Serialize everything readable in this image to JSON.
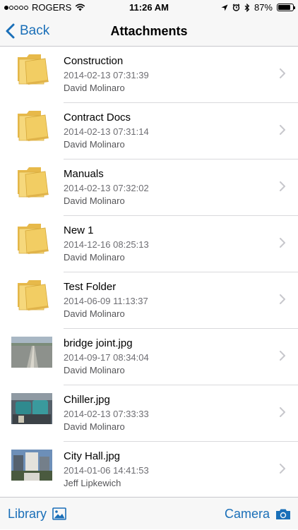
{
  "status_bar": {
    "carrier": "ROGERS",
    "time": "11:26 AM",
    "battery": "87%",
    "battery_level": 0.87,
    "signal_bars_filled": 1,
    "signal_bars_total": 5,
    "icons": [
      "wifi-icon",
      "location-icon",
      "alarm-icon",
      "bluetooth-icon"
    ]
  },
  "nav": {
    "back_label": "Back",
    "title": "Attachments"
  },
  "colors": {
    "accent": "#1a6fb8",
    "folder": "#f2cd63",
    "secondary_text": "#6d6d72"
  },
  "items": [
    {
      "kind": "folder",
      "name": "Construction",
      "date": "2014-02-13 07:31:39",
      "user": "David Molinaro"
    },
    {
      "kind": "folder",
      "name": "Contract Docs",
      "date": "2014-02-13 07:31:14",
      "user": "David Molinaro"
    },
    {
      "kind": "folder",
      "name": "Manuals",
      "date": "2014-02-13 07:32:02",
      "user": "David Molinaro"
    },
    {
      "kind": "folder",
      "name": "New 1",
      "date": "2014-12-16 08:25:13",
      "user": "David Molinaro"
    },
    {
      "kind": "folder",
      "name": "Test Folder",
      "date": "2014-06-09 11:13:37",
      "user": "David Molinaro"
    },
    {
      "kind": "image",
      "name": "bridge joint.jpg",
      "date": "2014-09-17 08:34:04",
      "user": "David Molinaro"
    },
    {
      "kind": "image",
      "name": "Chiller.jpg",
      "date": "2014-02-13 07:33:33",
      "user": "David Molinaro"
    },
    {
      "kind": "image",
      "name": "City Hall.jpg",
      "date": "2014-01-06 14:41:53",
      "user": "Jeff Lipkewich"
    }
  ],
  "toolbar": {
    "library_label": "Library",
    "camera_label": "Camera"
  }
}
